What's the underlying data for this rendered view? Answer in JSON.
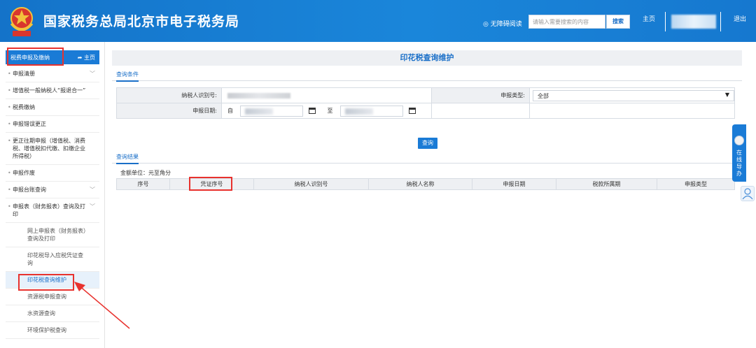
{
  "header": {
    "site_title": "国家税务总局北京市电子税务局",
    "accessibility": "◎ 无障碍阅读",
    "search_placeholder": "请输入需要搜索的内容",
    "search_button": "搜索",
    "home": "主页",
    "logout": "退出"
  },
  "sidebar": {
    "head_label": "税费申报及缴纳",
    "home": "主页",
    "items": [
      {
        "label": "申报清册"
      },
      {
        "label": "增值税一般纳税人“报退合一”"
      },
      {
        "label": "税费缴纳"
      },
      {
        "label": "申报错误更正"
      },
      {
        "label": "更正往期申报（增值税、消费税、增值税扣代缴、扣缴企业所得税）"
      },
      {
        "label": "申报作废"
      },
      {
        "label": "申报台账查询"
      },
      {
        "label": "申报表（财务报表）查询及打印"
      },
      {
        "label": "网上申报表（财务报表）查询及打印"
      },
      {
        "label": "印花税导入应税凭证查询"
      },
      {
        "label": "印花税查询维护"
      },
      {
        "label": "资源税申报查询"
      },
      {
        "label": "水资源查询"
      },
      {
        "label": "环境保护税查询"
      }
    ]
  },
  "main": {
    "title": "印花税查询维护",
    "query_tab": "查询条件",
    "taxpayer_id_label": "纳税人识别号:",
    "declare_type_label": "申报类型:",
    "declare_type_value": "全部",
    "declare_date_label": "申报日期:",
    "from_label": "自",
    "to_label": "至",
    "query_button": "查询",
    "result_tab": "查询结果",
    "unit_text": "金额单位：元至角分",
    "columns": [
      "序号",
      "凭证序号",
      "纳税人识别号",
      "纳税人名称",
      "申报日期",
      "税款所属期",
      "申报类型"
    ]
  },
  "float_guide": {
    "text": [
      "在",
      "线",
      "导",
      "办"
    ]
  },
  "colors": {
    "primary": "#1a7bd6",
    "highlight": "#e8322e"
  }
}
